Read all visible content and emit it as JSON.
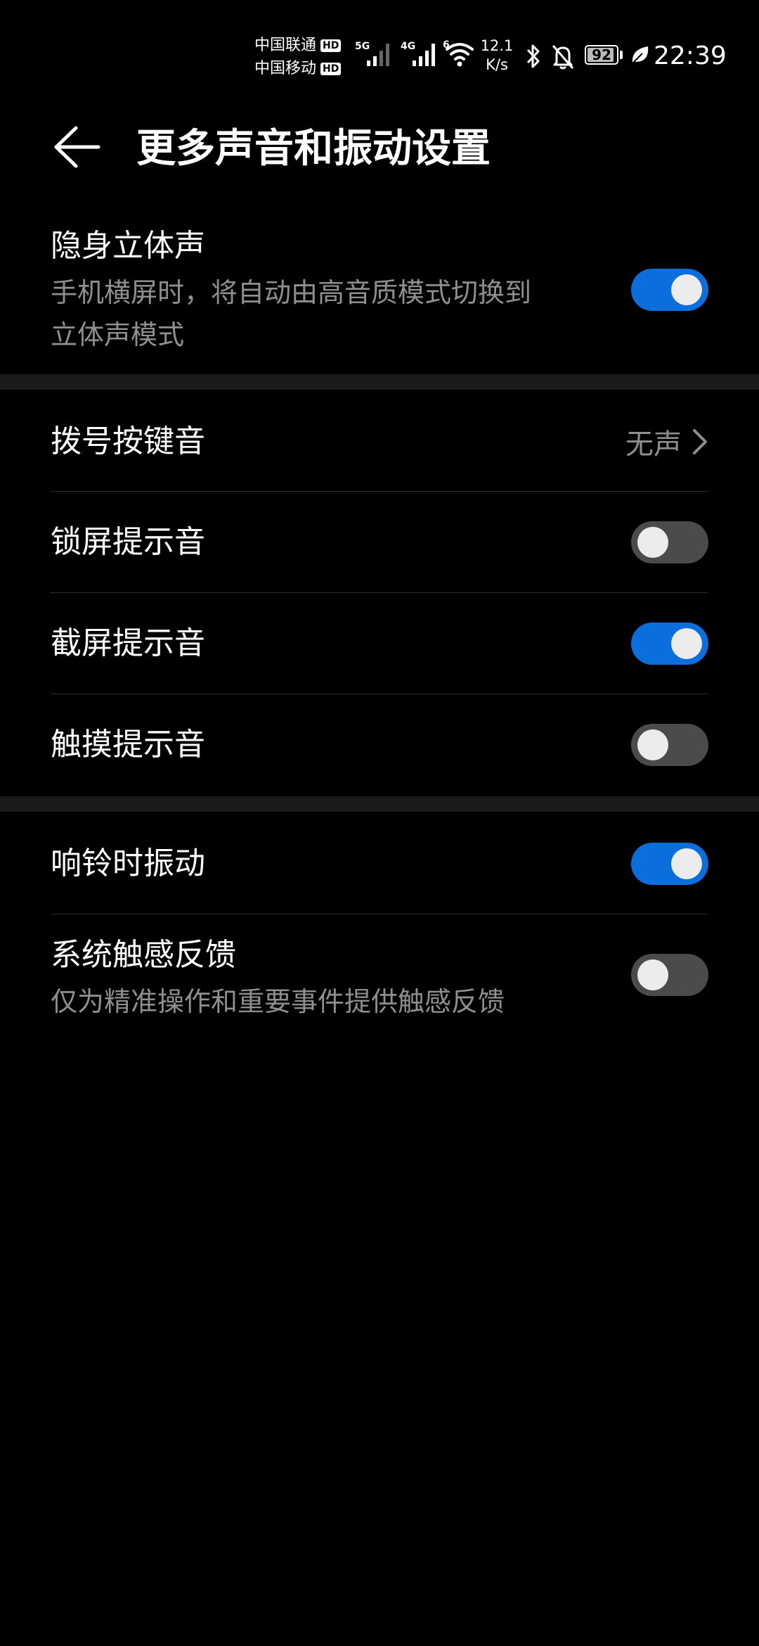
{
  "status_bar": {
    "carrier1": "中国联通",
    "carrier2": "中国移动",
    "hd": "HD",
    "net1": "5G",
    "net2": "4G",
    "wifi_tag": "6",
    "speed_value": "12.1",
    "speed_unit": "K/s",
    "battery": "92",
    "battery_level": 0.92,
    "time": "22:39"
  },
  "header": {
    "title": "更多声音和振动设置"
  },
  "settings": {
    "stealth_stereo": {
      "title": "隐身立体声",
      "subtitle1": "手机横屏时，将自动由高音质模式切换到",
      "subtitle2": "立体声模式",
      "enabled": true
    },
    "dial_tone": {
      "title": "拨号按键音",
      "value": "无声"
    },
    "lock_sound": {
      "title": "锁屏提示音",
      "enabled": false
    },
    "screenshot_sound": {
      "title": "截屏提示音",
      "enabled": true
    },
    "touch_sound": {
      "title": "触摸提示音",
      "enabled": false
    },
    "vibrate_on_ring": {
      "title": "响铃时振动",
      "enabled": true
    },
    "haptic_feedback": {
      "title": "系统触感反馈",
      "subtitle": "仅为精准操作和重要事件提供触感反馈",
      "enabled": false
    }
  },
  "colors": {
    "accent": "#0a6edc",
    "background": "#000000",
    "secondary_text": "#8f8f8f",
    "section_gap": "#1b1b1b"
  }
}
